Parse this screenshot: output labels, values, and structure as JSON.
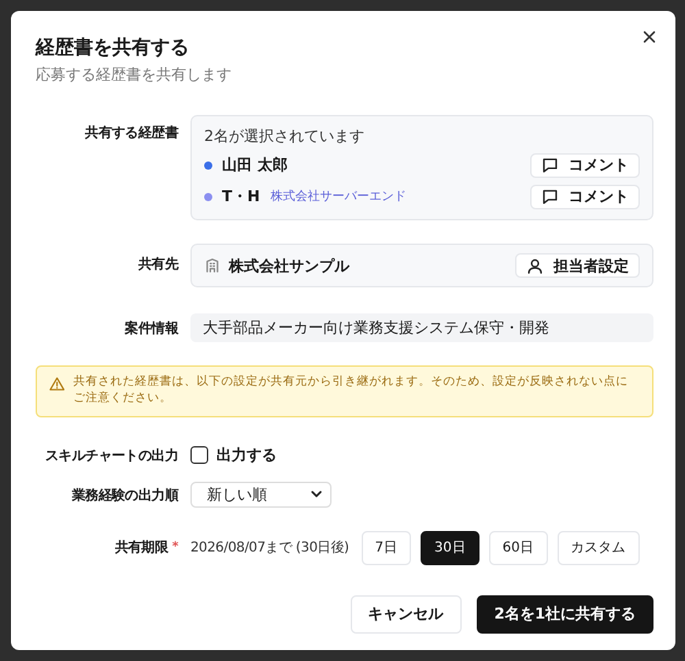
{
  "dialog": {
    "title": "経歴書を共有する",
    "subtitle": "応募する経歴書を共有します"
  },
  "resumes": {
    "label": "共有する経歴書",
    "summary": "2名が選択されています",
    "items": [
      {
        "name": "山田 太郎",
        "color": "#3b6fe8",
        "comment_button": "コメント"
      },
      {
        "name": "T・H",
        "company": "株式会社サーバーエンド",
        "color": "#8b8ff0",
        "comment_button": "コメント"
      }
    ]
  },
  "share_to": {
    "label": "共有先",
    "company": "株式会社サンプル",
    "assign_button": "担当者設定"
  },
  "case_info": {
    "label": "案件情報",
    "value": "大手部品メーカー向け業務支援システム保守・開発"
  },
  "warning": "共有された経歴書は、以下の設定が共有元から引き継がれます。そのため、設定が反映されない点にご注意ください。",
  "skill_chart": {
    "label": "スキルチャートの出力",
    "option": "出力する",
    "checked": false
  },
  "order": {
    "label": "業務経験の出力順",
    "value": "新しい順"
  },
  "period": {
    "label": "共有期限",
    "required_mark": "*",
    "until": "2026/08/07まで (30日後)",
    "options": [
      {
        "label": "7日",
        "selected": false
      },
      {
        "label": "30日",
        "selected": true
      },
      {
        "label": "60日",
        "selected": false
      },
      {
        "label": "カスタム",
        "selected": false
      }
    ]
  },
  "buttons": {
    "cancel": "キャンセル",
    "submit": "2名を1社に共有する"
  }
}
